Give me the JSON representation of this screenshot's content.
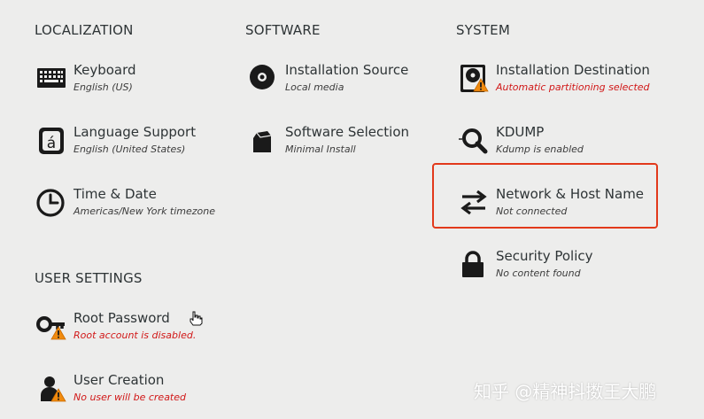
{
  "sections": {
    "localization": "LOCALIZATION",
    "software": "SOFTWARE",
    "system": "SYSTEM",
    "user_settings": "USER SETTINGS"
  },
  "spokes": {
    "keyboard": {
      "title": "Keyboard",
      "status": "English (US)",
      "icon": "keyboard-icon"
    },
    "language": {
      "title": "Language Support",
      "status": "English (United States)",
      "icon": "language-icon"
    },
    "time": {
      "title": "Time & Date",
      "status": "Americas/New York timezone",
      "icon": "clock-icon"
    },
    "source": {
      "title": "Installation Source",
      "status": "Local media",
      "icon": "disc-icon"
    },
    "software": {
      "title": "Software Selection",
      "status": "Minimal Install",
      "icon": "package-icon"
    },
    "destination": {
      "title": "Installation Destination",
      "status": "Automatic partitioning selected",
      "icon": "harddisk-icon"
    },
    "kdump": {
      "title": "KDUMP",
      "status": "Kdump is enabled",
      "icon": "magnifier-icon"
    },
    "network": {
      "title": "Network & Host Name",
      "status": "Not connected",
      "icon": "network-arrows-icon"
    },
    "security": {
      "title": "Security Policy",
      "status": "No content found",
      "icon": "lock-icon"
    },
    "root": {
      "title": "Root Password",
      "status": "Root account is disabled.",
      "icon": "key-icon"
    },
    "user": {
      "title": "User Creation",
      "status": "No user will be created",
      "icon": "user-icon"
    }
  },
  "colors": {
    "warning_text": "#d11818",
    "highlight_border": "#e2391b",
    "background": "#ededec"
  },
  "watermark": "知乎 @精神抖擞王大鹏"
}
